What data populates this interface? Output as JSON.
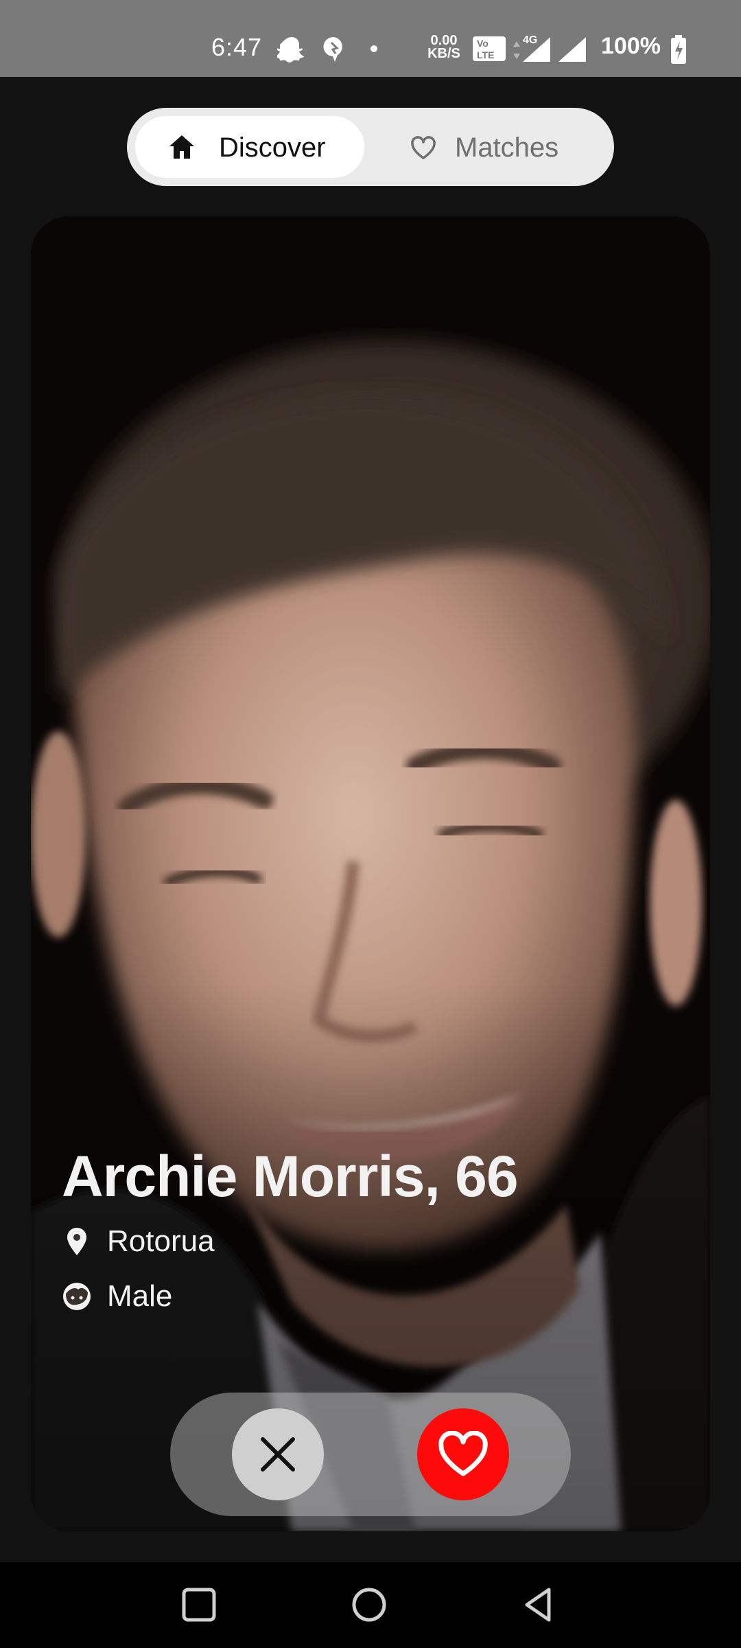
{
  "status_bar": {
    "time": "6:47",
    "net_speed_value": "0.00",
    "net_speed_unit": "KB/S",
    "network": "4G",
    "battery": "100%"
  },
  "tabs": [
    {
      "label": "Discover",
      "icon": "home-icon",
      "active": true
    },
    {
      "label": "Matches",
      "icon": "heart-outline-icon",
      "active": false
    }
  ],
  "profile": {
    "name_age": "Archie Morris, 66",
    "location": "Rotorua",
    "gender": "Male"
  },
  "actions": {
    "dislike_icon": "close-icon",
    "like_icon": "heart-icon",
    "like_color": "#ff0a0a"
  },
  "nav": [
    "recent-apps-icon",
    "home-circle-icon",
    "back-icon"
  ]
}
